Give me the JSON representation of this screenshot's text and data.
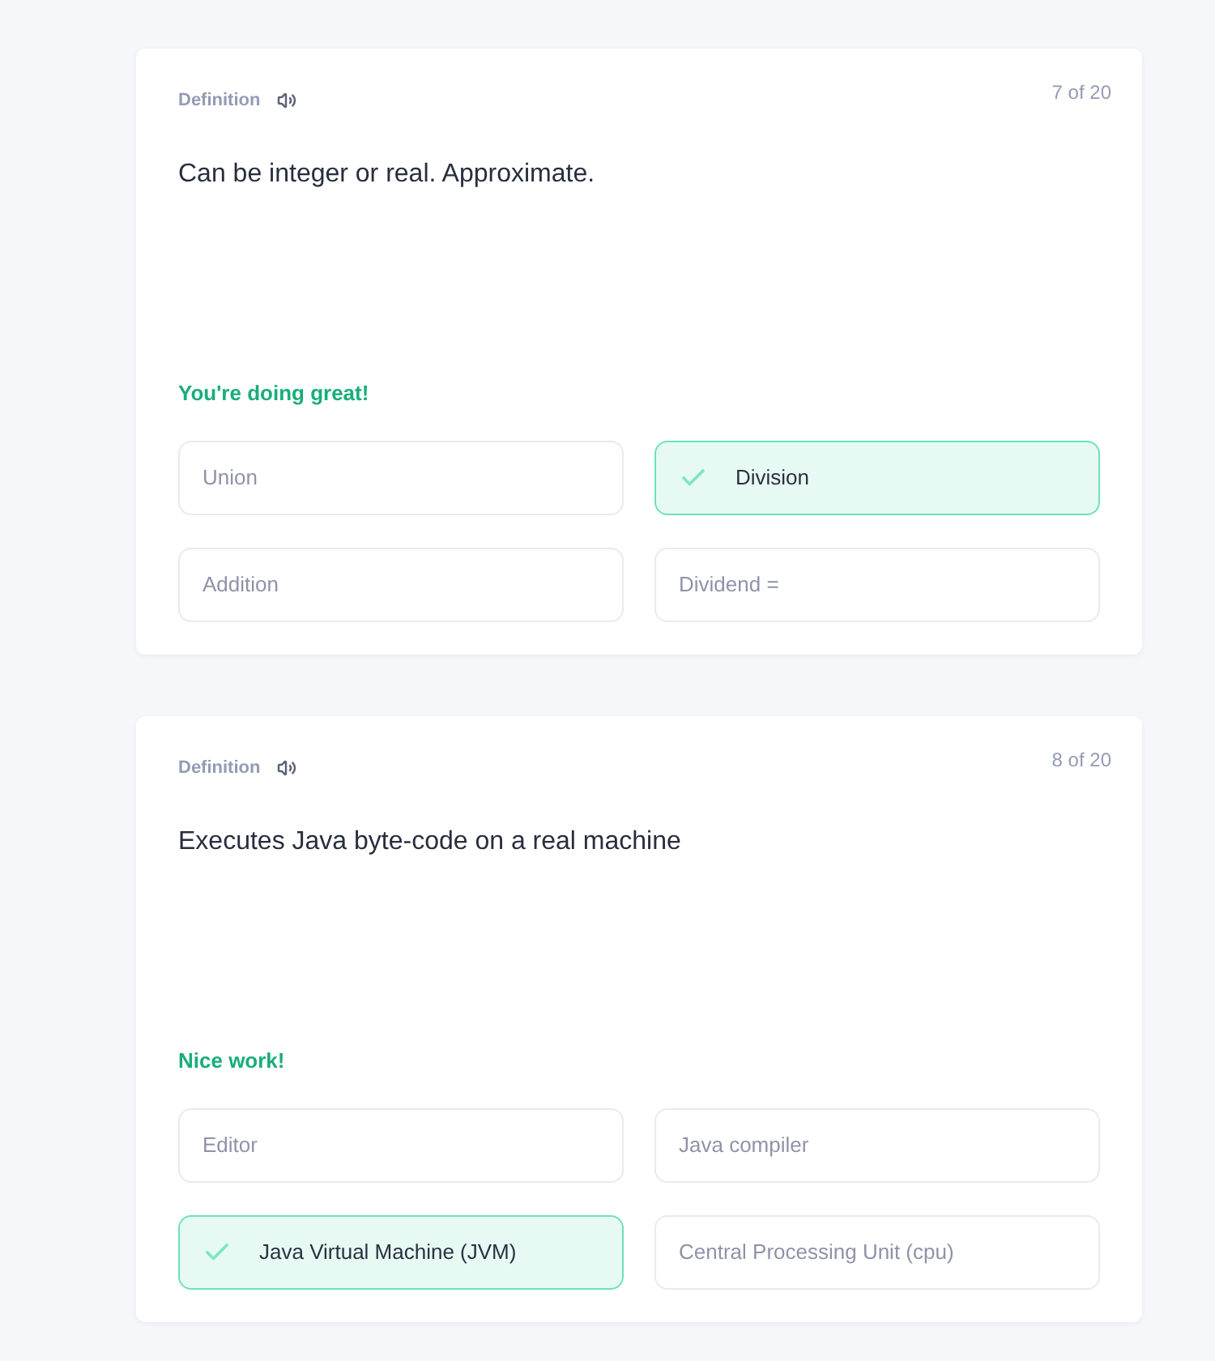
{
  "cards": [
    {
      "label": "Definition",
      "counter": "7 of 20",
      "question": "Can be integer or real. Approximate.",
      "feedback": "You're doing great!",
      "options": [
        {
          "label": "Union",
          "selected": false
        },
        {
          "label": "Division",
          "selected": true
        },
        {
          "label": "Addition",
          "selected": false
        },
        {
          "label": "Dividend =",
          "selected": false
        }
      ]
    },
    {
      "label": "Definition",
      "counter": "8 of 20",
      "question": "Executes Java byte-code on a real machine",
      "feedback": "Nice work!",
      "options": [
        {
          "label": "Editor",
          "selected": false
        },
        {
          "label": "Java compiler",
          "selected": false
        },
        {
          "label": "Java Virtual Machine (JVM)",
          "selected": true
        },
        {
          "label": "Central Processing Unit (cpu)",
          "selected": false
        }
      ]
    }
  ]
}
